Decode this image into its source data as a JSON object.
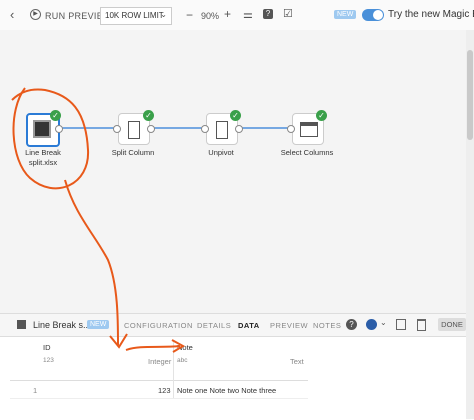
{
  "toolbar": {
    "back_glyph": "‹",
    "run_preview_label": "RUN PREVIEW",
    "row_limit_label": "10K ROW LIMIT",
    "zoom_out_glyph": "−",
    "zoom_level": "90%",
    "zoom_in_glyph": "+",
    "new_badge": "NEW",
    "magic_etl_label": "Try the new Magic ETL"
  },
  "nodes": [
    {
      "label": "Line Break\nsplit.xlsx",
      "icon": "excel-file-icon"
    },
    {
      "label": "Split Column",
      "icon": "split-column-icon"
    },
    {
      "label": "Unpivot",
      "icon": "unpivot-icon"
    },
    {
      "label": "Select Columns",
      "icon": "select-columns-icon"
    }
  ],
  "panel": {
    "title": "Line Break s...",
    "new_badge": "NEW",
    "tabs": [
      "CONFIGURATION",
      "DETAILS",
      "DATA",
      "PREVIEW",
      "NOTES"
    ],
    "active_tab": "DATA",
    "done_label": "DONE"
  },
  "table": {
    "columns": [
      {
        "name": "ID",
        "type_icon": "123",
        "type": "Integer"
      },
      {
        "name": "Note",
        "type_icon": "abc",
        "type": "Text"
      }
    ],
    "rows": [
      {
        "index": "1",
        "id": "123",
        "note": "Note one Note two Note three"
      }
    ]
  },
  "colors": {
    "accent": "#2b7bd6",
    "success": "#3aa04a",
    "annotation": "#e8591a"
  }
}
